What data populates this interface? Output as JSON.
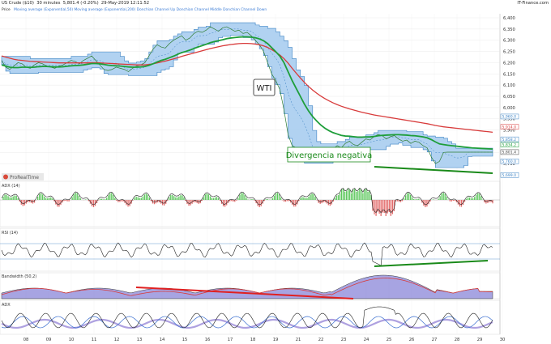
{
  "header": {
    "instrument": "US Crude ($10)",
    "timeframe": "30 minutes",
    "quote": "5,801.4 (-0.20%)",
    "datetime": "29-May-2019 12:11:52",
    "source": "IT-Finance.com"
  },
  "legend": {
    "price_label": "Price",
    "items": "Moving average (Exponential,50)   Moving average (Exponential,200)   Donchian Channel Up   Donchian Channel Middle   Donchian Channel Down"
  },
  "annotations": {
    "wti": "WTI",
    "divergence": "Divergencia negativa",
    "logo": "ProRealTime"
  },
  "panels": {
    "adx": "ADX (14)",
    "rsi": "RSI (14)",
    "bandwidth": "Bandwidth (50,2)",
    "adx2": "ADX"
  },
  "colors": {
    "price": "#2e7d32",
    "ema50": "#1e9e3a",
    "ema200": "#d83b3b",
    "channel_fill": "#a9cdf0",
    "channel_edge": "#3b82c4",
    "divergence": "#1a8a1a",
    "red_line": "#e02020",
    "adx_fill": "#8a86d8"
  },
  "chart_data": [
    {
      "type": "line",
      "name": "price",
      "ylim": [
        5700,
        6400
      ],
      "yticks": [
        "6,400",
        "6,350",
        "6,300",
        "6,250",
        "6,200",
        "6,150",
        "6,100",
        "6,050",
        "6,000",
        "5,950",
        "5,900",
        "5,850",
        "5,800",
        "5,750"
      ],
      "xlabels": [
        "08",
        "09",
        "10",
        "11",
        "12",
        "13",
        "14",
        "15",
        "16",
        "17",
        "18",
        "19",
        "21",
        "22",
        "23",
        "24",
        "25",
        "26",
        "27",
        "28",
        "29",
        "30"
      ],
      "price_tags": [
        "5,960.0",
        "5,914.0",
        "5,858.2",
        "5,834.2",
        "5,801.4",
        "5,760.0",
        "5,699.0"
      ],
      "x": [
        0,
        1,
        2,
        3,
        4,
        5,
        6,
        7,
        8,
        9,
        10,
        11,
        12,
        13,
        14,
        15,
        16,
        17,
        18,
        19,
        20,
        21,
        22,
        23,
        24,
        25,
        26,
        27,
        28,
        29,
        30,
        31,
        32,
        33,
        34,
        35,
        36,
        37,
        38,
        39,
        40,
        41,
        42,
        43,
        44,
        45,
        46,
        47,
        48,
        49,
        50,
        51,
        52,
        53,
        54,
        55,
        56,
        57,
        58,
        59,
        60,
        61,
        62,
        63,
        64,
        65,
        66,
        67,
        68,
        69,
        70,
        71,
        72,
        73,
        74,
        75,
        76,
        77,
        78,
        79,
        80,
        81,
        82,
        83,
        84,
        85,
        86,
        87,
        88,
        89,
        90,
        91,
        92,
        93,
        94,
        95,
        96,
        97,
        98,
        99,
        100,
        101,
        102,
        103,
        104,
        105,
        106,
        107,
        108,
        109,
        110,
        111,
        112,
        113,
        114,
        115,
        116,
        117,
        118,
        119,
        120
      ],
      "series": [
        {
          "values": [
            6210,
            6180,
            6170,
            6185,
            6200,
            6195,
            6180,
            6175,
            6190,
            6200,
            6195,
            6185,
            6180,
            6175,
            6185,
            6190,
            6200,
            6210,
            6205,
            6195,
            6210,
            6220,
            6230,
            6210,
            6190,
            6170,
            6165,
            6170,
            6180,
            6175,
            6170,
            6160,
            6175,
            6185,
            6190,
            6200,
            6230,
            6260,
            6280,
            6270,
            6265,
            6285,
            6300,
            6310,
            6320,
            6300,
            6310,
            6330,
            6340,
            6335,
            6345,
            6360,
            6350,
            6340,
            6355,
            6360,
            6350,
            6340,
            6345,
            6330,
            6335,
            6320,
            6300,
            6280,
            6250,
            6200,
            6150,
            6120,
            6080,
            5990,
            5880,
            5830,
            5820,
            5800,
            5770,
            5790,
            5810,
            5820,
            5800,
            5810,
            5820,
            5815,
            5830,
            5820,
            5840,
            5850,
            5835,
            5830,
            5845,
            5860,
            5855,
            5870,
            5880,
            5875,
            5860,
            5870,
            5875,
            5860,
            5850,
            5855,
            5840,
            5850,
            5845,
            5830,
            5820,
            5780,
            5750,
            5760,
            5800,
            5801,
            5801,
            5801,
            5801,
            5801,
            5801,
            5801,
            5801,
            5801,
            5801,
            5801,
            5801
          ]
        },
        {
          "name": "EMA50",
          "values": [
            6190,
            6185,
            6180,
            6178,
            6178,
            6180,
            6180,
            6179,
            6180,
            6182,
            6183,
            6183,
            6182,
            6181,
            6181,
            6182,
            6184,
            6186,
            6187,
            6188,
            6190,
            6193,
            6196,
            6196,
            6195,
            6192,
            6189,
            6187,
            6186,
            6185,
            6183,
            6181,
            6180,
            6180,
            6181,
            6183,
            6188,
            6195,
            6203,
            6210,
            6215,
            6222,
            6229,
            6237,
            6245,
            6250,
            6256,
            6263,
            6270,
            6276,
            6282,
            6289,
            6294,
            6298,
            6302,
            6307,
            6310,
            6312,
            6314,
            6315,
            6315,
            6314,
            6311,
            6306,
            6298,
            6285,
            6267,
            6249,
            6229,
            6200,
            6160,
            6120,
            6085,
            6050,
            6015,
            5985,
            5960,
            5940,
            5922,
            5908,
            5897,
            5888,
            5882,
            5876,
            5873,
            5872,
            5870,
            5868,
            5868,
            5869,
            5869,
            5871,
            5874,
            5876,
            5877,
            5878,
            5879,
            5879,
            5878,
            5877,
            5875,
            5874,
            5872,
            5869,
            5865,
            5857,
            5847,
            5838,
            5835,
            5832,
            5830,
            5828,
            5826,
            5824,
            5822,
            5820,
            5819,
            5818,
            5817,
            5816,
            5815
          ]
        },
        {
          "name": "EMA200",
          "values": [
            6230,
            6225,
            6220,
            6215,
            6212,
            6210,
            6208,
            6206,
            6205,
            6204,
            6203,
            6202,
            6201,
            6200,
            6199,
            6199,
            6199,
            6199,
            6199,
            6199,
            6199,
            6199,
            6200,
            6200,
            6199,
            6198,
            6197,
            6196,
            6195,
            6194,
            6193,
            6192,
            6191,
            6190,
            6190,
            6190,
            6192,
            6195,
            6199,
            6203,
            6207,
            6212,
            6217,
            6222,
            6228,
            6233,
            6238,
            6243,
            6248,
            6253,
            6258,
            6263,
            6267,
            6271,
            6275,
            6278,
            6281,
            6283,
            6285,
            6286,
            6286,
            6285,
            6283,
            6280,
            6275,
            6268,
            6258,
            6247,
            6234,
            6218,
            6198,
            6175,
            6153,
            6132,
            6112,
            6094,
            6078,
            6064,
            6051,
            6040,
            6030,
            6021,
            6013,
            6006,
            6000,
            5994,
            5989,
            5984,
            5979,
            5975,
            5971,
            5967,
            5964,
            5961,
            5958,
            5955,
            5952,
            5949,
            5946,
            5943,
            5940,
            5937,
            5934,
            5931,
            5928,
            5924,
            5920,
            5917,
            5914,
            5912,
            5910,
            5908,
            5906,
            5904,
            5902,
            5900,
            5898,
            5896,
            5894,
            5892,
            5890
          ]
        }
      ]
    }
  ]
}
